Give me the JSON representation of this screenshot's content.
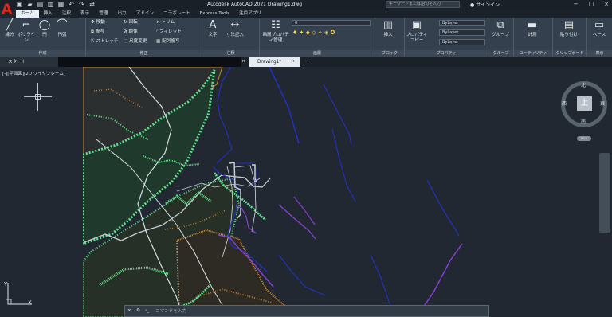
{
  "app": {
    "logo": "A",
    "title": "Autodesk AutoCAD 2021   Drawing1.dwg",
    "search_placeholder": "キーワードまたは語句を入力",
    "user": "サインイン",
    "qat_icons": [
      "new-icon",
      "open-icon",
      "save-icon",
      "save-as-icon",
      "print-icon",
      "undo-icon",
      "redo-icon",
      "share-icon"
    ]
  },
  "ribbon_tabs": [
    "ホーム",
    "挿入",
    "注釈",
    "表示",
    "管理",
    "出力",
    "アドイン",
    "コラボレート",
    "Express Tools",
    "注目アプリ"
  ],
  "panels": {
    "draw": {
      "label": "作成",
      "tools": [
        "線分",
        "ポリライン",
        "円",
        "円弧"
      ]
    },
    "modify": {
      "label": "修正",
      "tools": [
        "移動",
        "回転",
        "トリム",
        "複写",
        "鏡像",
        "フィレット",
        "ストレッチ",
        "尺度変更",
        "配列複写"
      ]
    },
    "annotation": {
      "label": "注釈",
      "tools": [
        "文字",
        "寸法記入"
      ]
    },
    "layers": {
      "label": "画層",
      "tools": [
        "画層プロパティ管理"
      ],
      "layer_value": "0"
    },
    "block": {
      "label": "ブロック",
      "tools": [
        "挿入"
      ]
    },
    "properties": {
      "label": "プロパティ",
      "tools": [
        "プロパティコピー"
      ],
      "values": [
        "ByLayer",
        "ByLayer",
        "ByLayer"
      ]
    },
    "groups": {
      "label": "グループ",
      "tools": [
        "グループ"
      ]
    },
    "utilities": {
      "label": "ユーティリティ",
      "tools": [
        "計測"
      ]
    },
    "clipboard": {
      "label": "クリップボード",
      "tools": [
        "貼り付け"
      ]
    },
    "view": {
      "label": "表示",
      "tools": [
        "ベース"
      ]
    }
  },
  "file_tabs": [
    "スタート",
    "Drawing1*"
  ],
  "viewport": {
    "label": "[-][平面図][2D ワイヤフレーム]",
    "compass": {
      "north": "北",
      "south": "南",
      "east": "東",
      "west": "西",
      "top": "上"
    },
    "wcs": "WCS",
    "ucs": {
      "x": "X",
      "y": "Y"
    }
  },
  "command_line": {
    "placeholder": "コマンドを入力"
  },
  "colors": {
    "background": "#212831",
    "ribbon": "#34404d",
    "accent": "#e2241a",
    "roads": "#c7cdd2",
    "terrain": "#c8832d",
    "vegetation": "#5de28b",
    "water": "#2431bf",
    "coast_purple": "#8540ce"
  }
}
